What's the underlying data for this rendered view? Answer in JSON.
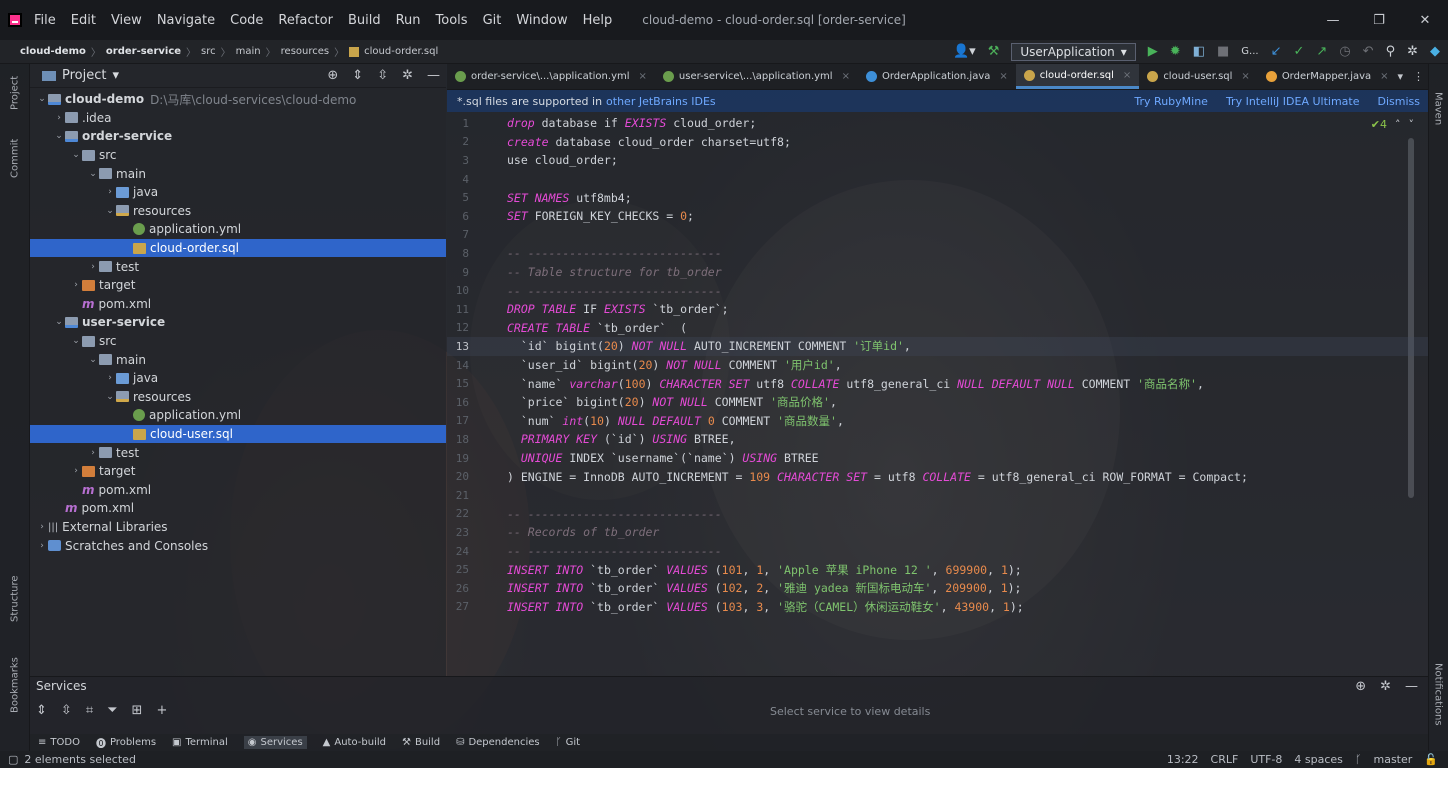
{
  "window": {
    "title": "cloud-demo - cloud-order.sql [order-service]",
    "menu": [
      "File",
      "Edit",
      "View",
      "Navigate",
      "Code",
      "Refactor",
      "Build",
      "Run",
      "Tools",
      "Git",
      "Window",
      "Help"
    ],
    "controls": [
      "—",
      "❐",
      "✕"
    ]
  },
  "breadcrumb": [
    "cloud-demo",
    "order-service",
    "src",
    "main",
    "resources",
    "cloud-order.sql"
  ],
  "toolbar": {
    "run_config": "UserApplication",
    "git_label": "G..."
  },
  "left_strip": [
    "Project",
    "Commit",
    "Structure",
    "Bookmarks"
  ],
  "right_strip": [
    "Maven",
    "Notifications"
  ],
  "project_panel": {
    "title": "Project",
    "tree": [
      {
        "label": "cloud-demo",
        "path": "D:\\马库\\cloud-services\\cloud-demo",
        "indent": 0,
        "arrow": "v",
        "icon": "module",
        "bold": true
      },
      {
        "label": ".idea",
        "indent": 1,
        "arrow": ">",
        "icon": "folder"
      },
      {
        "label": "order-service",
        "indent": 1,
        "arrow": "v",
        "icon": "module",
        "bold": true
      },
      {
        "label": "src",
        "indent": 2,
        "arrow": "v",
        "icon": "folder"
      },
      {
        "label": "main",
        "indent": 3,
        "arrow": "v",
        "icon": "folder"
      },
      {
        "label": "java",
        "indent": 4,
        "arrow": ">",
        "icon": "folder-src"
      },
      {
        "label": "resources",
        "indent": 4,
        "arrow": "v",
        "icon": "res"
      },
      {
        "label": "application.yml",
        "indent": 5,
        "arrow": "",
        "icon": "yml"
      },
      {
        "label": "cloud-order.sql",
        "indent": 5,
        "arrow": "",
        "icon": "sql",
        "selected": true
      },
      {
        "label": "test",
        "indent": 3,
        "arrow": ">",
        "icon": "folder"
      },
      {
        "label": "target",
        "indent": 2,
        "arrow": ">",
        "icon": "folder-target"
      },
      {
        "label": "pom.xml",
        "indent": 2,
        "arrow": "",
        "icon": "maven"
      },
      {
        "label": "user-service",
        "indent": 1,
        "arrow": "v",
        "icon": "module",
        "bold": true
      },
      {
        "label": "src",
        "indent": 2,
        "arrow": "v",
        "icon": "folder"
      },
      {
        "label": "main",
        "indent": 3,
        "arrow": "v",
        "icon": "folder"
      },
      {
        "label": "java",
        "indent": 4,
        "arrow": ">",
        "icon": "folder-src"
      },
      {
        "label": "resources",
        "indent": 4,
        "arrow": "v",
        "icon": "res"
      },
      {
        "label": "application.yml",
        "indent": 5,
        "arrow": "",
        "icon": "yml"
      },
      {
        "label": "cloud-user.sql",
        "indent": 5,
        "arrow": "",
        "icon": "sql",
        "selected": true
      },
      {
        "label": "test",
        "indent": 3,
        "arrow": ">",
        "icon": "folder"
      },
      {
        "label": "target",
        "indent": 2,
        "arrow": ">",
        "icon": "folder-target"
      },
      {
        "label": "pom.xml",
        "indent": 2,
        "arrow": "",
        "icon": "maven"
      },
      {
        "label": "pom.xml",
        "indent": 1,
        "arrow": "",
        "icon": "maven"
      },
      {
        "label": "External Libraries",
        "indent": 0,
        "arrow": ">",
        "icon": "lib"
      },
      {
        "label": "Scratches and Consoles",
        "indent": 0,
        "arrow": ">",
        "icon": "scratch"
      }
    ]
  },
  "editor": {
    "tabs": [
      {
        "label": "order-service\\...\\application.yml",
        "icon_color": "#6a9d4d"
      },
      {
        "label": "user-service\\...\\application.yml",
        "icon_color": "#6a9d4d"
      },
      {
        "label": "OrderApplication.java",
        "icon_color": "#3d8fd8"
      },
      {
        "label": "cloud-order.sql",
        "icon_color": "#c9a54b",
        "active": true
      },
      {
        "label": "cloud-user.sql",
        "icon_color": "#c9a54b"
      },
      {
        "label": "OrderMapper.java",
        "icon_color": "#e8a13a"
      }
    ],
    "banner": {
      "text": "*.sql files are supported in",
      "link": "other JetBrains IDEs",
      "actions": [
        "Try RubyMine",
        "Try IntelliJ IDEA Ultimate",
        "Dismiss"
      ]
    },
    "inspection": "✔4",
    "current_line": 13,
    "lines": [
      {
        "n": "1",
        "tokens": [
          [
            "kw",
            "drop"
          ],
          [
            "t",
            " database if "
          ],
          [
            "kw",
            "EXISTS"
          ],
          [
            "t",
            " cloud_order;"
          ]
        ]
      },
      {
        "n": "2",
        "tokens": [
          [
            "kw",
            "create"
          ],
          [
            "t",
            " database cloud_order charset=utf8;"
          ]
        ]
      },
      {
        "n": "3",
        "tokens": [
          [
            "t",
            "use cloud_order;"
          ]
        ]
      },
      {
        "n": "4",
        "tokens": []
      },
      {
        "n": "5",
        "tokens": [
          [
            "kw",
            "SET NAMES"
          ],
          [
            "t",
            " utf8mb4;"
          ]
        ]
      },
      {
        "n": "6",
        "tokens": [
          [
            "kw",
            "SET"
          ],
          [
            "t",
            " FOREIGN_KEY_CHECKS = "
          ],
          [
            "num",
            "0"
          ],
          [
            "t",
            ";"
          ]
        ]
      },
      {
        "n": "7",
        "tokens": []
      },
      {
        "n": "8",
        "tokens": [
          [
            "cmt",
            "-- ----------------------------"
          ]
        ]
      },
      {
        "n": "9",
        "tokens": [
          [
            "cmt",
            "-- Table structure for tb_order"
          ]
        ]
      },
      {
        "n": "10",
        "tokens": [
          [
            "cmt",
            "-- ----------------------------"
          ]
        ]
      },
      {
        "n": "11",
        "tokens": [
          [
            "kw",
            "DROP TABLE"
          ],
          [
            "t",
            " IF "
          ],
          [
            "kw",
            "EXISTS"
          ],
          [
            "t",
            " `tb_order`;"
          ]
        ]
      },
      {
        "n": "12",
        "tokens": [
          [
            "kw",
            "CREATE TABLE"
          ],
          [
            "t",
            " `tb_order`  ("
          ]
        ]
      },
      {
        "n": "13",
        "tokens": [
          [
            "t",
            "  `id` bigint("
          ],
          [
            "num",
            "20"
          ],
          [
            "t",
            ") "
          ],
          [
            "kw",
            "NOT NULL"
          ],
          [
            "t",
            " AUTO_INCREMENT COMMENT "
          ],
          [
            "str",
            "'订单id'"
          ],
          [
            "t",
            ","
          ]
        ]
      },
      {
        "n": "14",
        "tokens": [
          [
            "t",
            "  `user_id` bigint("
          ],
          [
            "num",
            "20"
          ],
          [
            "t",
            ") "
          ],
          [
            "kw",
            "NOT NULL"
          ],
          [
            "t",
            " COMMENT "
          ],
          [
            "str",
            "'用户id'"
          ],
          [
            "t",
            ","
          ]
        ]
      },
      {
        "n": "15",
        "tokens": [
          [
            "t",
            "  `name` "
          ],
          [
            "kw",
            "varchar"
          ],
          [
            "t",
            "("
          ],
          [
            "num",
            "100"
          ],
          [
            "t",
            ") "
          ],
          [
            "kw",
            "CHARACTER SET"
          ],
          [
            "t",
            " utf8 "
          ],
          [
            "kw",
            "COLLATE"
          ],
          [
            "t",
            " utf8_general_ci "
          ],
          [
            "kw",
            "NULL DEFAULT NULL"
          ],
          [
            "t",
            " COMMENT "
          ],
          [
            "str",
            "'商品名称'"
          ],
          [
            "t",
            ","
          ]
        ]
      },
      {
        "n": "16",
        "tokens": [
          [
            "t",
            "  `price` bigint("
          ],
          [
            "num",
            "20"
          ],
          [
            "t",
            ") "
          ],
          [
            "kw",
            "NOT NULL"
          ],
          [
            "t",
            " COMMENT "
          ],
          [
            "str",
            "'商品价格'"
          ],
          [
            "t",
            ","
          ]
        ]
      },
      {
        "n": "17",
        "tokens": [
          [
            "t",
            "  `num` "
          ],
          [
            "kw",
            "int"
          ],
          [
            "t",
            "("
          ],
          [
            "num",
            "10"
          ],
          [
            "t",
            ") "
          ],
          [
            "kw",
            "NULL DEFAULT"
          ],
          [
            "t",
            " "
          ],
          [
            "num",
            "0"
          ],
          [
            "t",
            " COMMENT "
          ],
          [
            "str",
            "'商品数量'"
          ],
          [
            "t",
            ","
          ]
        ]
      },
      {
        "n": "18",
        "tokens": [
          [
            "t",
            "  "
          ],
          [
            "kw",
            "PRIMARY KEY"
          ],
          [
            "t",
            " (`id`) "
          ],
          [
            "kw",
            "USING"
          ],
          [
            "t",
            " BTREE,"
          ]
        ]
      },
      {
        "n": "19",
        "tokens": [
          [
            "t",
            "  "
          ],
          [
            "kw",
            "UNIQUE"
          ],
          [
            "t",
            " INDEX `username`(`name`) "
          ],
          [
            "kw",
            "USING"
          ],
          [
            "t",
            " BTREE"
          ]
        ]
      },
      {
        "n": "20",
        "tokens": [
          [
            "t",
            ") ENGINE = InnoDB AUTO_INCREMENT = "
          ],
          [
            "num",
            "109"
          ],
          [
            "t",
            " "
          ],
          [
            "kw",
            "CHARACTER SET"
          ],
          [
            "t",
            " = utf8 "
          ],
          [
            "kw",
            "COLLATE"
          ],
          [
            "t",
            " = utf8_general_ci ROW_FORMAT = Compact;"
          ]
        ]
      },
      {
        "n": "21",
        "tokens": []
      },
      {
        "n": "22",
        "tokens": [
          [
            "cmt",
            "-- ----------------------------"
          ]
        ]
      },
      {
        "n": "23",
        "tokens": [
          [
            "cmt",
            "-- Records of tb_order"
          ]
        ]
      },
      {
        "n": "24",
        "tokens": [
          [
            "cmt",
            "-- ----------------------------"
          ]
        ]
      },
      {
        "n": "25",
        "tokens": [
          [
            "kw",
            "INSERT INTO"
          ],
          [
            "t",
            " `tb_order` "
          ],
          [
            "kw",
            "VALUES"
          ],
          [
            "t",
            " ("
          ],
          [
            "num",
            "101"
          ],
          [
            "t",
            ", "
          ],
          [
            "num",
            "1"
          ],
          [
            "t",
            ", "
          ],
          [
            "str",
            "'Apple 苹果 iPhone 12 '"
          ],
          [
            "t",
            ", "
          ],
          [
            "num",
            "699900"
          ],
          [
            "t",
            ", "
          ],
          [
            "num",
            "1"
          ],
          [
            "t",
            ");"
          ]
        ]
      },
      {
        "n": "26",
        "tokens": [
          [
            "kw",
            "INSERT INTO"
          ],
          [
            "t",
            " `tb_order` "
          ],
          [
            "kw",
            "VALUES"
          ],
          [
            "t",
            " ("
          ],
          [
            "num",
            "102"
          ],
          [
            "t",
            ", "
          ],
          [
            "num",
            "2"
          ],
          [
            "t",
            ", "
          ],
          [
            "str",
            "'雅迪 yadea 新国标电动车'"
          ],
          [
            "t",
            ", "
          ],
          [
            "num",
            "209900"
          ],
          [
            "t",
            ", "
          ],
          [
            "num",
            "1"
          ],
          [
            "t",
            ");"
          ]
        ]
      },
      {
        "n": "27",
        "tokens": [
          [
            "kw",
            "INSERT INTO"
          ],
          [
            "t",
            " `tb_order` "
          ],
          [
            "kw",
            "VALUES"
          ],
          [
            "t",
            " ("
          ],
          [
            "num",
            "103"
          ],
          [
            "t",
            ", "
          ],
          [
            "num",
            "3"
          ],
          [
            "t",
            ", "
          ],
          [
            "str",
            "'骆驼（CAMEL）休闲运动鞋女'"
          ],
          [
            "t",
            ", "
          ],
          [
            "num",
            "43900"
          ],
          [
            "t",
            ", "
          ],
          [
            "num",
            "1"
          ],
          [
            "t",
            ");"
          ]
        ]
      }
    ]
  },
  "services": {
    "title": "Services",
    "placeholder": "Select service to view details"
  },
  "tool_tabs": [
    "TODO",
    "Problems",
    "Terminal",
    "Services",
    "Auto-build",
    "Build",
    "Dependencies",
    "Git"
  ],
  "status": {
    "left": "2 elements selected",
    "position": "13:22",
    "line_sep": "CRLF",
    "encoding": "UTF-8",
    "indent": "4 spaces",
    "branch": "master"
  }
}
